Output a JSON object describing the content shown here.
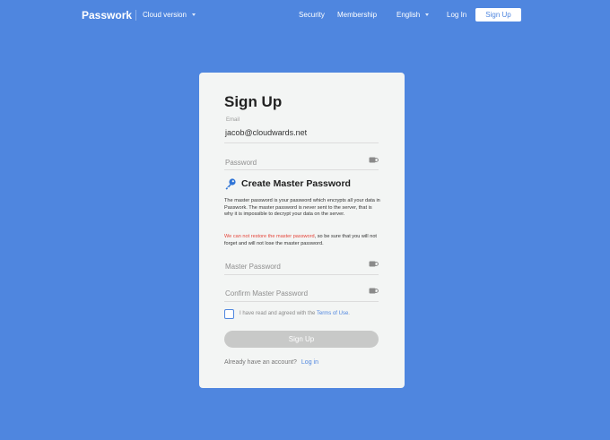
{
  "nav": {
    "logo": "Passwork",
    "version": "Cloud version",
    "security": "Security",
    "membership": "Membership",
    "language": "English",
    "login": "Log In",
    "signup": "Sign Up"
  },
  "form": {
    "title": "Sign Up",
    "email_label": "Email",
    "email_value": "jacob@cloudwards.net",
    "password_placeholder": "Password",
    "section_title": "Create Master Password",
    "description": "The master password is your password which encrypts all your data in Passwork. The master password is never sent to the server, that is why it is impossible to decrypt your data on the server.",
    "warning_red": "We can not restore the master password",
    "warning_rest": ", so be sure that you will not forget and will not lose the master password.",
    "master_placeholder": "Master Password",
    "confirm_placeholder": "Confirm Master Password",
    "terms_prefix": "I have read and agreed with the ",
    "terms_link": "Terms of Use",
    "terms_suffix": ".",
    "submit": "Sign Up",
    "have_account": "Already have an account?",
    "login_link": "Log in"
  },
  "colors": {
    "background": "#4f86df",
    "card": "#f3f5f4",
    "warning": "#e5453a",
    "button_disabled": "#c8c9c8"
  },
  "icons": {
    "key": "key-icon",
    "eye": "eye-icon",
    "caret": "chevron-down-icon"
  }
}
